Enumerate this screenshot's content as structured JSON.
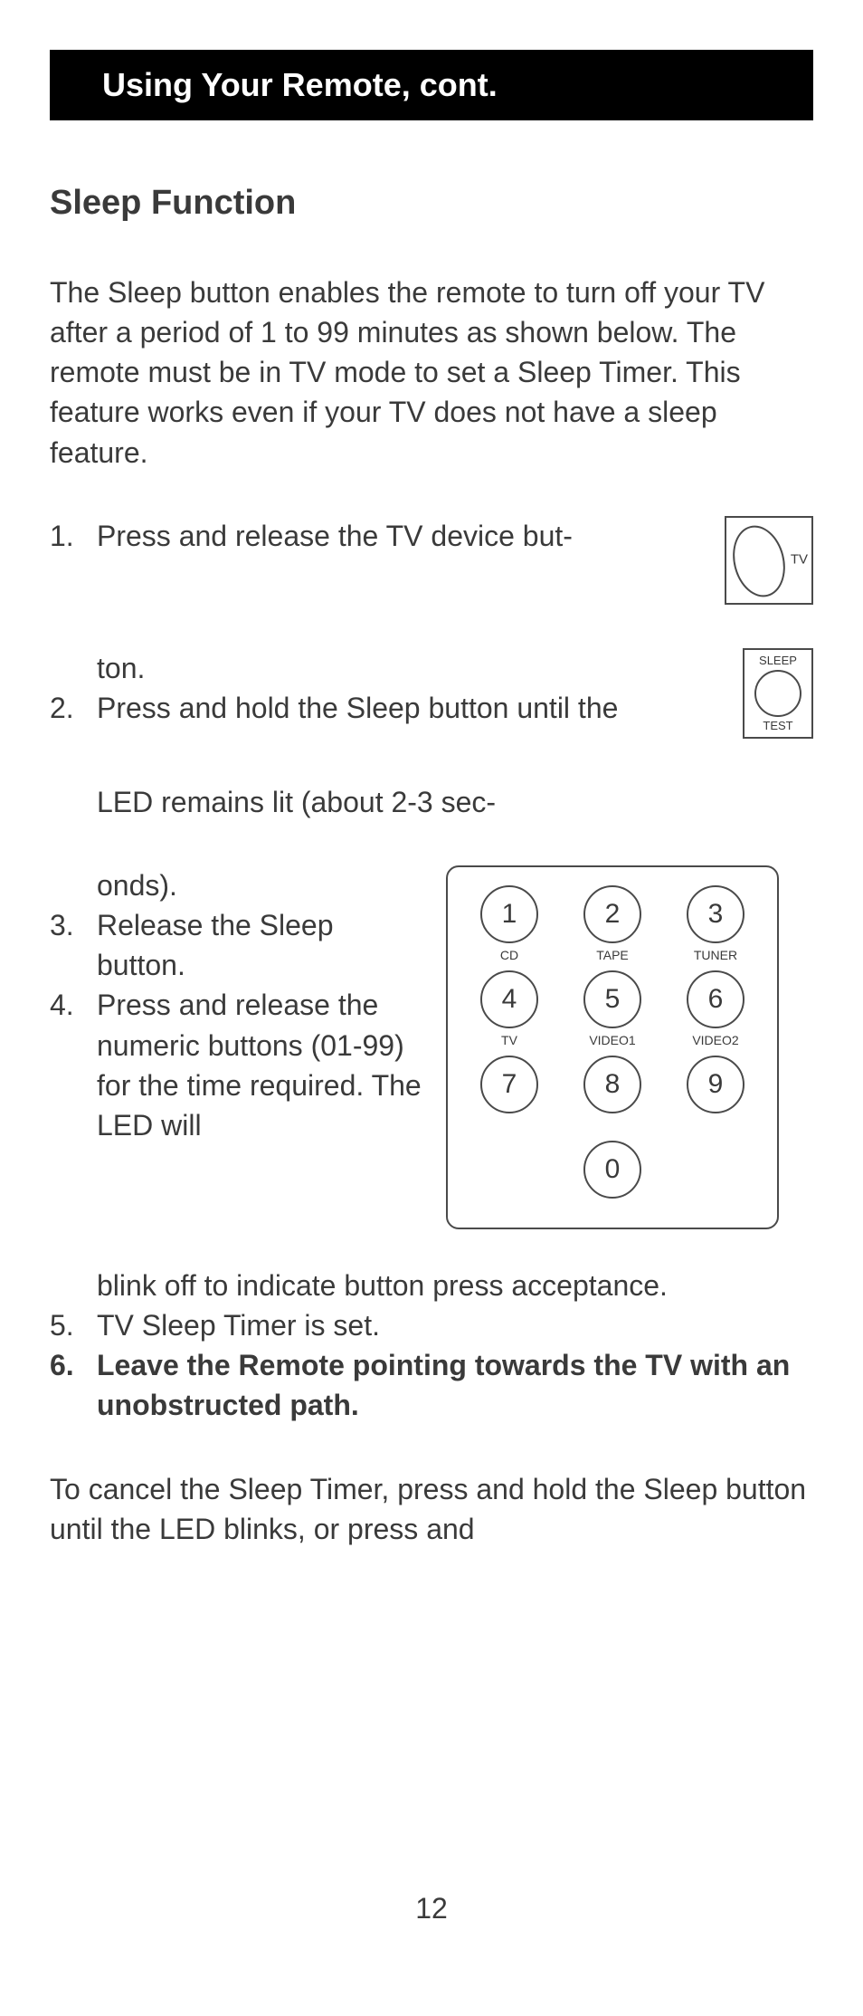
{
  "header": {
    "title": "Using Your Remote, cont."
  },
  "section": {
    "title": "Sleep Function"
  },
  "intro": "The Sleep button enables the remote to turn off your TV after a period of 1 to 99 minutes as shown below. The remote must be in TV mode to set a Sleep Timer. This feature works even if your TV does not have a sleep feature.",
  "steps": {
    "s1_num": "1.",
    "s1a": "Press and release the TV device but-",
    "s1b": "ton.",
    "s2_num": "2.",
    "s2a": "Press and hold the Sleep button until the",
    "s2b": "LED remains lit (about 2-3 sec-",
    "s2c": "onds).",
    "s3_num": "3.",
    "s3": "Release the Sleep button.",
    "s4_num": "4.",
    "s4a": "Press and release the numeric buttons (01-99) for the time required. The LED will",
    "s4b": "blink off to indicate button press acceptance.",
    "s5_num": "5.",
    "s5": "TV Sleep Timer is set.",
    "s6_num": "6.",
    "s6": "Leave the Remote pointing towards the TV with an unobstructed path."
  },
  "cancel": "To cancel the Sleep Timer, press and hold the Sleep button until the LED blinks, or press and",
  "page_number": "12",
  "tv_button": {
    "label": "TV"
  },
  "sleep_button": {
    "top": "SLEEP",
    "bottom": "TEST"
  },
  "keypad": {
    "buttons": [
      {
        "digit": "1",
        "label": "CD"
      },
      {
        "digit": "2",
        "label": "TAPE"
      },
      {
        "digit": "3",
        "label": "TUNER"
      },
      {
        "digit": "4",
        "label": "TV"
      },
      {
        "digit": "5",
        "label": "VIDEO1"
      },
      {
        "digit": "6",
        "label": "VIDEO2"
      },
      {
        "digit": "7",
        "label": ""
      },
      {
        "digit": "8",
        "label": ""
      },
      {
        "digit": "9",
        "label": ""
      },
      {
        "digit": "0",
        "label": ""
      }
    ]
  }
}
